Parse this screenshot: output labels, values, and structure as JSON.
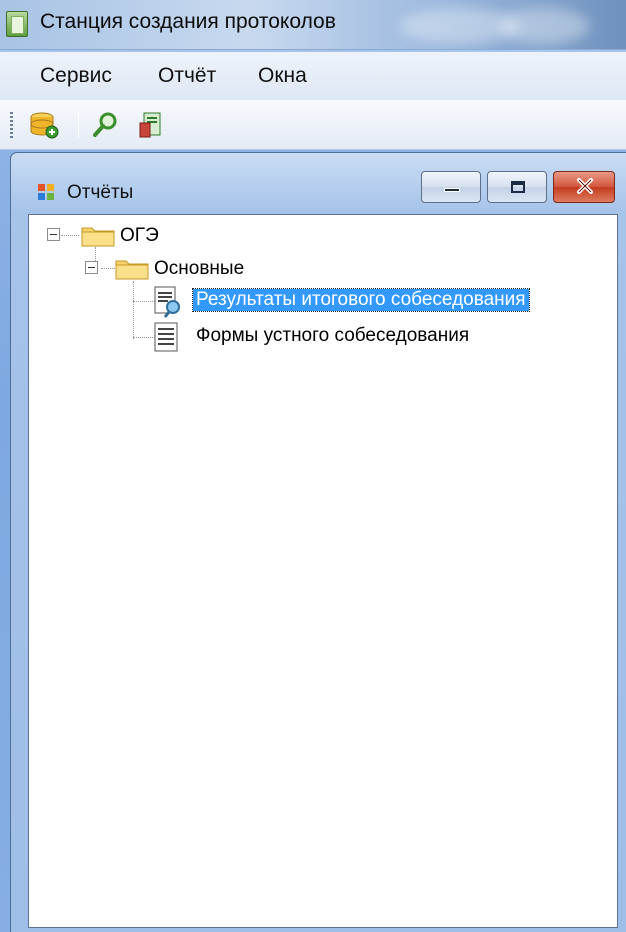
{
  "window": {
    "title": "Станция создания протоколов"
  },
  "menu": {
    "items": [
      "Сервис",
      "Отчёт",
      "Окна"
    ]
  },
  "toolbar": {
    "buttons": [
      "database-icon",
      "search-icon",
      "report-icon"
    ]
  },
  "child": {
    "title": "Отчёты"
  },
  "tree": {
    "root": "ОГЭ",
    "group": "Основные",
    "items": [
      {
        "label": "Результаты итогового собеседования",
        "selected": true
      },
      {
        "label": "Формы устного собеседования",
        "selected": false
      }
    ]
  },
  "colors": {
    "selection": "#3399ff",
    "close": "#c23b1e"
  }
}
